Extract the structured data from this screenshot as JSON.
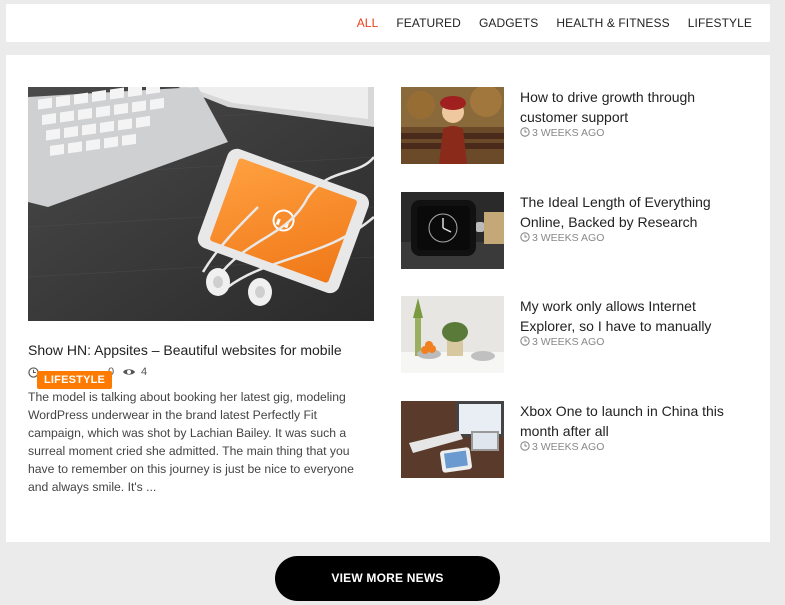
{
  "tabs": [
    {
      "label": "ALL",
      "active": true
    },
    {
      "label": "FEATURED"
    },
    {
      "label": "GADGETS"
    },
    {
      "label": "HEALTH & FITNESS"
    },
    {
      "label": "LIFESTYLE"
    }
  ],
  "featured": {
    "title": "Show HN: Appsites – Beautiful websites for mobile",
    "category": "LIFESTYLE",
    "comments": "0",
    "views": "4",
    "excerpt": "The model is talking about booking her latest gig, modeling WordPress underwear in the brand latest Perfectly Fit campaign, which was shot by Lachian Bailey. It was such a surreal moment cried she admitted. The main thing that you have to remember on this journey is just be nice to everyone and always smile. It's ..."
  },
  "posts": [
    {
      "title": "How to drive growth through customer support",
      "time": "3 WEEKS AGO"
    },
    {
      "title": "The Ideal Length of Everything Online, Backed by Research",
      "time": "3 WEEKS AGO"
    },
    {
      "title": "My work only allows Internet Explorer, so I have to manually",
      "time": "3 WEEKS AGO"
    },
    {
      "title": "Xbox One to launch in China this month after all",
      "time": "3 WEEKS AGO"
    }
  ],
  "view_more_label": "VIEW MORE NEWS",
  "colors": {
    "accent": "#e8401c",
    "badge": "#ff7a00",
    "button": "#000000"
  }
}
